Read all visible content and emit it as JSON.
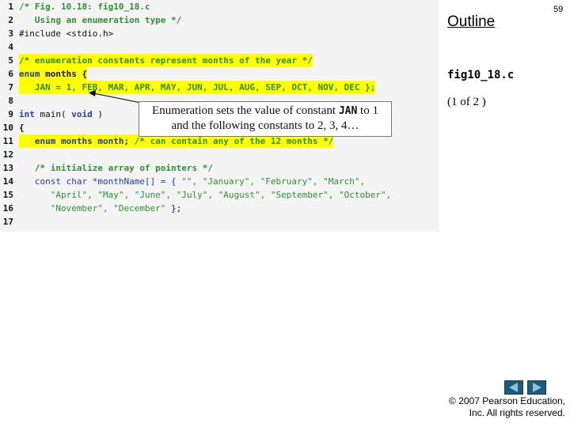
{
  "slide": {
    "outline_label": "Outline",
    "page_number": "59",
    "file_name": "fig10_18.c",
    "part_of": "(1 of 2 )",
    "copyright_line1": "© 2007 Pearson Education,",
    "copyright_line2": "Inc.  All rights reserved."
  },
  "callout": {
    "text_before": "Enumeration sets the value of constant ",
    "constant": "JAN",
    "text_after": " to 1",
    "line2": "and the following constants to 2, 3, 4…"
  },
  "code": {
    "line_numbers": [
      "1",
      "2",
      "3",
      "4",
      "5",
      "6",
      "7",
      "8",
      "9",
      "10",
      "11",
      "12",
      "13",
      "14",
      "15",
      "16",
      "17"
    ],
    "l1": "/* Fig. 10.18: fig10_18.c",
    "l2": "   Using an enumeration type */",
    "l3": "#include <stdio.h>",
    "l5": "/* enumeration constants represent months of the year */",
    "l6_kw": "enum",
    "l6_rest": " months {",
    "l7": "   JAN = 1, FEB, MAR, APR, MAY, JUN, JUL, AUG, SEP, OCT, NOV, DEC };",
    "l9_kw1": "int",
    "l9_mid": " main( ",
    "l9_kw2": "void",
    "l9_end": " )",
    "l10": "{",
    "l11_code": "   enum months month; ",
    "l11_comment": "/* can contain any of the 12 months */",
    "l13": "   /* initialize array of pointers */",
    "l14_pre": "   const char *monthName[] = { ",
    "l14_strs": "\"\", \"January\", \"February\", \"March\",",
    "l15": "      \"April\", \"May\", \"June\", \"July\", \"August\", \"September\", \"October\",",
    "l16_strs": "      \"November\", \"December\"",
    "l16_end": " };"
  }
}
